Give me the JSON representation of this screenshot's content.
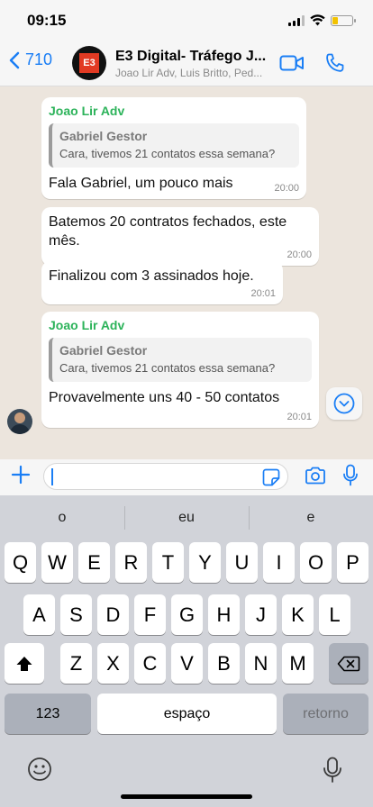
{
  "status_bar": {
    "time": "09:15",
    "battery_level": 0.3,
    "battery_color": "#f2c200"
  },
  "header": {
    "back_count": "710",
    "group_name": "E3 Digital- Tráfego J...",
    "group_avatar_text": "E3",
    "members": "Joao Lir Adv, Luis Britto, Ped...",
    "icons": [
      "chevron-left-icon",
      "video-call-icon",
      "phone-icon"
    ],
    "accent": "#1a7ef5"
  },
  "messages": [
    {
      "sender": "Joao Lir Adv",
      "quote": {
        "author": "Gabriel Gestor",
        "text": "Cara, tivemos 21 contatos essa semana?"
      },
      "text": "Fala Gabriel, um pouco mais",
      "time": "20:00"
    },
    {
      "text": "Batemos 20 contratos fechados, este mês.",
      "time": "20:00"
    },
    {
      "text": "Finalizou com 3 assinados hoje.",
      "time": "20:01"
    },
    {
      "sender": "Joao Lir Adv",
      "quote": {
        "author": "Gabriel Gestor",
        "text": "Cara, tivemos 21 contatos essa semana?"
      },
      "text": "Provavelmente uns 40 - 50 contatos",
      "time": "20:01"
    }
  ],
  "sender_color": "#2cb35a",
  "input": {
    "value": "",
    "placeholder": ""
  },
  "keyboard": {
    "suggestions": [
      "o",
      "eu",
      "e"
    ],
    "row1": [
      "Q",
      "W",
      "E",
      "R",
      "T",
      "Y",
      "U",
      "I",
      "O",
      "P"
    ],
    "row2": [
      "A",
      "S",
      "D",
      "F",
      "G",
      "H",
      "J",
      "K",
      "L"
    ],
    "row3": [
      "Z",
      "X",
      "C",
      "V",
      "B",
      "N",
      "M"
    ],
    "numbers_label": "123",
    "space_label": "espaço",
    "return_label": "retorno"
  }
}
